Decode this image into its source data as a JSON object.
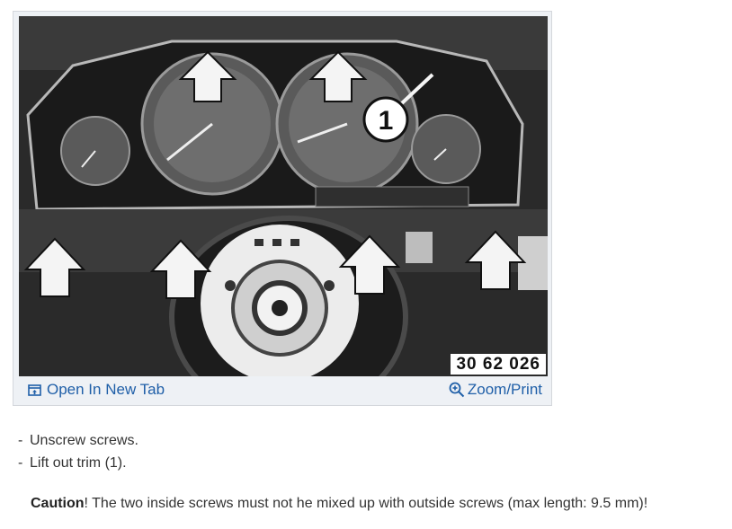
{
  "figure": {
    "image_code": "30 62 026",
    "callout_number": "1",
    "open_link_label": "Open In New Tab",
    "zoom_link_label": "Zoom/Print"
  },
  "steps": [
    {
      "dash": "-",
      "text": "Unscrew screws."
    },
    {
      "dash": "-",
      "text": "Lift out trim (1)."
    }
  ],
  "caution": {
    "label": "Caution",
    "text": "! The two inside screws must not he mixed up with outside screws (max length: 9.5 mm)!"
  },
  "colors": {
    "link": "#1f5fa8",
    "text": "#333333",
    "bar_background": "#eef1f5"
  },
  "icons": {
    "open": "open-in-new-tab-icon",
    "zoom": "zoom-in-icon",
    "arrow": "up-arrow-icon"
  }
}
